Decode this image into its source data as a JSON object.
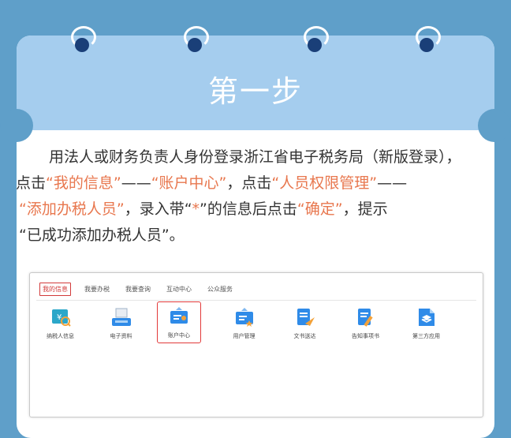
{
  "header": {
    "title": "第一步"
  },
  "instructions": {
    "lines": [
      [
        {
          "text": "　　用法人或财务负责人身份登录浙江省电子税务局（新版登录），",
          "hl": false
        }
      ],
      [
        {
          "text": "点击",
          "hl": false
        },
        {
          "text": "“我的信息”",
          "hl": true
        },
        {
          "text": "——",
          "hl": false
        },
        {
          "text": "“账户中心”",
          "hl": true
        },
        {
          "text": "，点击",
          "hl": false
        },
        {
          "text": "“人员权限管理”",
          "hl": true
        },
        {
          "text": "——",
          "hl": false
        }
      ],
      [
        {
          "text": "“添加办税人员”",
          "hl": true
        },
        {
          "text": "，录入带“",
          "hl": false
        },
        {
          "text": "*",
          "hl": true
        },
        {
          "text": "”的信息后点击",
          "hl": false
        },
        {
          "text": "“确定”",
          "hl": true
        },
        {
          "text": "，提示",
          "hl": false
        }
      ],
      [
        {
          "text": "“已成功添加办税人员”。",
          "hl": false
        }
      ]
    ]
  },
  "screenshot": {
    "nav_tabs": [
      {
        "label": "我的信息",
        "active": true
      },
      {
        "label": "我要办税",
        "active": false
      },
      {
        "label": "我要查询",
        "active": false
      },
      {
        "label": "互动中心",
        "active": false
      },
      {
        "label": "公众服务",
        "active": false
      }
    ],
    "apps": [
      {
        "label": "纳税人信息",
        "icon": "taxpayer-info-icon",
        "selected": false
      },
      {
        "label": "电子资料",
        "icon": "electronic-docs-icon",
        "selected": false
      },
      {
        "label": "账户中心",
        "icon": "account-center-icon",
        "selected": true
      },
      {
        "label": "用户管理",
        "icon": "user-management-icon",
        "selected": false
      },
      {
        "label": "文书送达",
        "icon": "document-delivery-icon",
        "selected": false
      },
      {
        "label": "告知事项书",
        "icon": "notice-book-icon",
        "selected": false
      },
      {
        "label": "第三方应用",
        "icon": "third-party-apps-icon",
        "selected": false
      }
    ]
  },
  "colors": {
    "background": "#5f9fc9",
    "header": "#a5cdee",
    "highlight": "#e8774e",
    "ring_hole": "#1a3f78",
    "selection": "#e23a3a"
  }
}
